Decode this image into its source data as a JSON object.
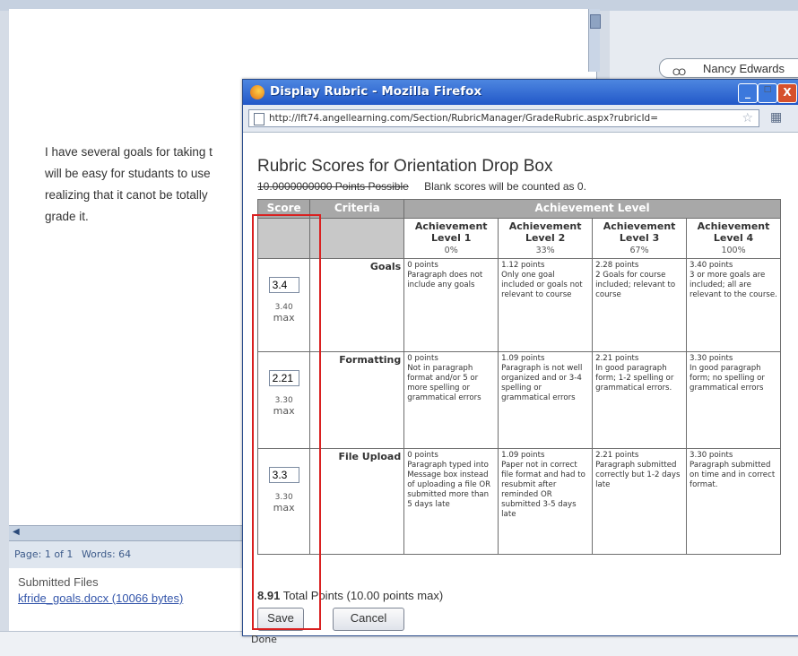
{
  "background": {
    "essay_lines": [
      "I have several goals for taking t",
      "will be easy for studants to use",
      "realizing that it canot be totally",
      "grade it."
    ],
    "user_name": "Nancy Edwards",
    "status": {
      "page": "Page: 1 of 1",
      "words": "Words: 64"
    },
    "submitted": {
      "label": "Submitted Files",
      "file_link": "kfride_goals.docx (10066 bytes)"
    },
    "done_text": "Done"
  },
  "popup": {
    "title": "Display Rubric - Mozilla Firefox",
    "url": "http://lft74.angellearning.com/Section/RubricManager/GradeRubric.aspx?rubricId=",
    "window_buttons": {
      "min": "_",
      "max": "□",
      "close": "X"
    },
    "icons": [
      "firefox-icon",
      "page-icon",
      "star-icon",
      "extension-icon"
    ]
  },
  "rubric": {
    "title": "Rubric Scores for Orientation Drop Box",
    "points_possible": "10.0000000000 Points Possible",
    "blank_note": "Blank scores will be counted as 0.",
    "headers": {
      "score": "Score",
      "criteria": "Criteria",
      "achievement": "Achievement Level"
    },
    "levels": [
      {
        "name": "Achievement",
        "sub": "Level 1",
        "pct": "0%"
      },
      {
        "name": "Achievement",
        "sub": "Level 2",
        "pct": "33%"
      },
      {
        "name": "Achievement",
        "sub": "Level 3",
        "pct": "67%"
      },
      {
        "name": "Achievement",
        "sub": "Level 4",
        "pct": "100%"
      }
    ],
    "rows": [
      {
        "criterion": "Goals",
        "score": "3.4",
        "max": "3.40",
        "max_word": "max",
        "cells": [
          "0 points\nParagraph does not include any goals",
          "1.12 points\nOnly one goal included or goals not relevant to course",
          "2.28 points\n2 Goals for course included; relevant to course",
          "3.40 points\n3 or more goals are included; all are relevant to the course."
        ]
      },
      {
        "criterion": "Formatting",
        "score": "2.21",
        "max": "3.30",
        "max_word": "max",
        "cells": [
          "0 points\nNot in paragraph format and/or 5 or more spelling or grammatical errors",
          "1.09 points\nParagraph is not well organized and or 3-4 spelling or grammatical errors",
          "2.21 points\nIn good paragraph form; 1-2 spelling or grammatical errors.",
          "3.30 points\nIn good paragraph form; no spelling or grammatical errors"
        ]
      },
      {
        "criterion": "File Upload",
        "score": "3.3",
        "max": "3.30",
        "max_word": "max",
        "cells": [
          "0 points\nParagraph typed into Message box instead of uploading a file OR submitted more than 5 days late",
          "1.09 points\nPaper not in correct file format and had to resubmit after reminded OR submitted 3-5 days late",
          "2.21 points\nParagraph submitted correctly but 1-2 days late",
          "3.30 points\nParagraph submitted on time and in correct format."
        ]
      }
    ],
    "total_value": "8.91",
    "total_label": "Total Points (10.00 points max)",
    "save_label": "Save",
    "cancel_label": "Cancel"
  },
  "colors": {
    "highlight": "#d92020",
    "titlebar": "#2f65d0",
    "header_gray": "#a8a8a8"
  }
}
